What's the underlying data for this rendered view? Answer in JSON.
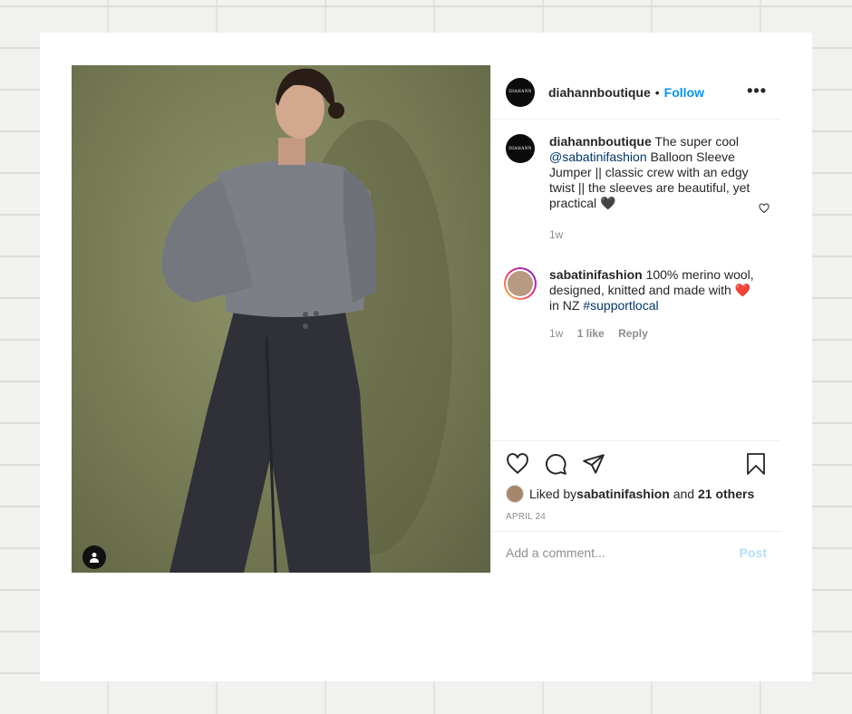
{
  "post": {
    "username": "diahannboutique",
    "avatar_text": "DIAHANN",
    "follow_label": "Follow",
    "separator": "•",
    "more_label": "•••"
  },
  "caption": {
    "username": "diahannboutique",
    "text_before": "The super cool ",
    "mention": "@sabatinifashion",
    "text_after": " Balloon Sleeve Jumper || classic crew with an edgy twist || the sleeves are beautiful, yet practical 🖤",
    "time": "1w"
  },
  "comment": {
    "username": "sabatinifashion",
    "text_before": "100% merino wool, designed, knitted and made with ",
    "emoji": "❤️",
    "text_middle": " in NZ ",
    "hashtag": "#supportlocal",
    "time": "1w",
    "likes": "1 like",
    "reply_label": "Reply"
  },
  "likes": {
    "prefix": "Liked by ",
    "user": "sabatinifashion",
    "and": " and ",
    "others": "21 others"
  },
  "date": "APRIL 24",
  "add_comment": {
    "placeholder": "Add a comment...",
    "post_label": "Post"
  },
  "colors": {
    "accent": "#0095f6",
    "link": "#00376b",
    "muted": "#8e8e8e",
    "background_photo": "#7b7f58"
  },
  "icons": [
    "heart-icon",
    "comment-icon",
    "share-icon",
    "bookmark-icon",
    "user-tag-icon",
    "more-icon"
  ]
}
